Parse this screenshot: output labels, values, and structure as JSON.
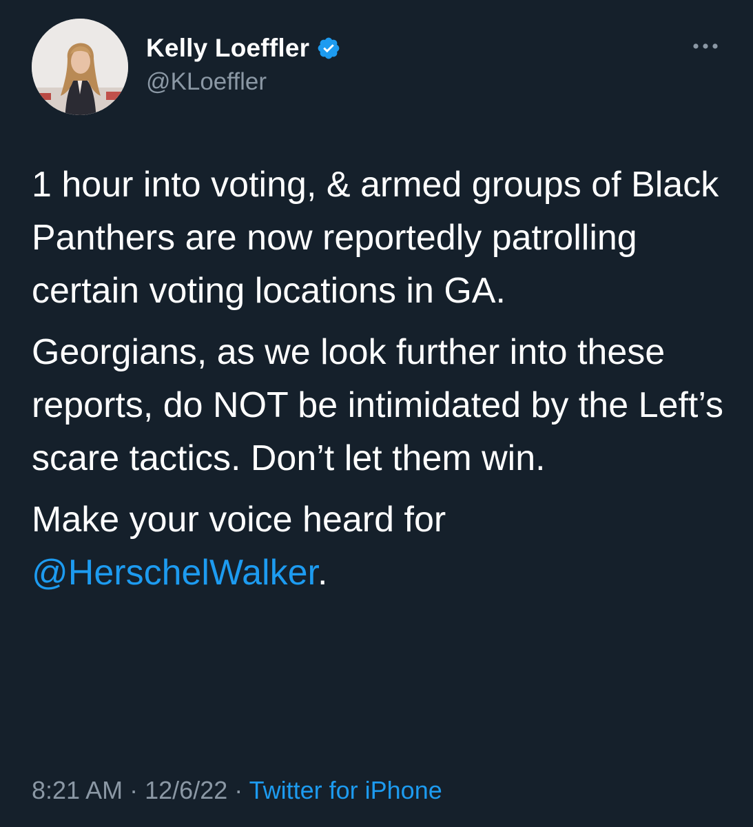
{
  "author": {
    "display_name": "Kelly Loeffler",
    "handle": "@KLoeffler",
    "verified_icon": "verified-badge-icon",
    "avatar_icon": "profile-photo"
  },
  "tweet": {
    "paragraph_1": "1 hour into voting, & armed groups of Black Panthers are now reportedly patrolling certain voting locations in GA.",
    "paragraph_2": "Georgians, as we look further into these reports, do NOT be intimidated by the Left’s scare tactics. Don’t let them win.",
    "paragraph_3_text": "Make your voice heard for",
    "paragraph_3_mention": "@HerschelWalker",
    "paragraph_3_end": "."
  },
  "footer": {
    "time": "8:21 AM",
    "separator": "·",
    "date": "12/6/22",
    "source": "Twitter for iPhone"
  },
  "colors": {
    "background": "#15202b",
    "text": "#ffffff",
    "secondary": "#8b98a5",
    "link": "#1d9bf0"
  }
}
